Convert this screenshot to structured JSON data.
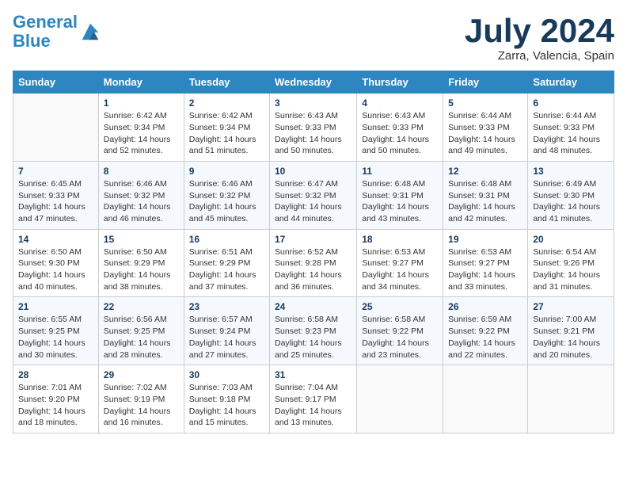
{
  "header": {
    "logo_line1": "General",
    "logo_line2": "Blue",
    "month_title": "July 2024",
    "subtitle": "Zarra, Valencia, Spain"
  },
  "calendar": {
    "days_of_week": [
      "Sunday",
      "Monday",
      "Tuesday",
      "Wednesday",
      "Thursday",
      "Friday",
      "Saturday"
    ],
    "weeks": [
      [
        {
          "day": "",
          "info": ""
        },
        {
          "day": "1",
          "info": "Sunrise: 6:42 AM\nSunset: 9:34 PM\nDaylight: 14 hours\nand 52 minutes."
        },
        {
          "day": "2",
          "info": "Sunrise: 6:42 AM\nSunset: 9:34 PM\nDaylight: 14 hours\nand 51 minutes."
        },
        {
          "day": "3",
          "info": "Sunrise: 6:43 AM\nSunset: 9:33 PM\nDaylight: 14 hours\nand 50 minutes."
        },
        {
          "day": "4",
          "info": "Sunrise: 6:43 AM\nSunset: 9:33 PM\nDaylight: 14 hours\nand 50 minutes."
        },
        {
          "day": "5",
          "info": "Sunrise: 6:44 AM\nSunset: 9:33 PM\nDaylight: 14 hours\nand 49 minutes."
        },
        {
          "day": "6",
          "info": "Sunrise: 6:44 AM\nSunset: 9:33 PM\nDaylight: 14 hours\nand 48 minutes."
        }
      ],
      [
        {
          "day": "7",
          "info": "Sunrise: 6:45 AM\nSunset: 9:33 PM\nDaylight: 14 hours\nand 47 minutes."
        },
        {
          "day": "8",
          "info": "Sunrise: 6:46 AM\nSunset: 9:32 PM\nDaylight: 14 hours\nand 46 minutes."
        },
        {
          "day": "9",
          "info": "Sunrise: 6:46 AM\nSunset: 9:32 PM\nDaylight: 14 hours\nand 45 minutes."
        },
        {
          "day": "10",
          "info": "Sunrise: 6:47 AM\nSunset: 9:32 PM\nDaylight: 14 hours\nand 44 minutes."
        },
        {
          "day": "11",
          "info": "Sunrise: 6:48 AM\nSunset: 9:31 PM\nDaylight: 14 hours\nand 43 minutes."
        },
        {
          "day": "12",
          "info": "Sunrise: 6:48 AM\nSunset: 9:31 PM\nDaylight: 14 hours\nand 42 minutes."
        },
        {
          "day": "13",
          "info": "Sunrise: 6:49 AM\nSunset: 9:30 PM\nDaylight: 14 hours\nand 41 minutes."
        }
      ],
      [
        {
          "day": "14",
          "info": "Sunrise: 6:50 AM\nSunset: 9:30 PM\nDaylight: 14 hours\nand 40 minutes."
        },
        {
          "day": "15",
          "info": "Sunrise: 6:50 AM\nSunset: 9:29 PM\nDaylight: 14 hours\nand 38 minutes."
        },
        {
          "day": "16",
          "info": "Sunrise: 6:51 AM\nSunset: 9:29 PM\nDaylight: 14 hours\nand 37 minutes."
        },
        {
          "day": "17",
          "info": "Sunrise: 6:52 AM\nSunset: 9:28 PM\nDaylight: 14 hours\nand 36 minutes."
        },
        {
          "day": "18",
          "info": "Sunrise: 6:53 AM\nSunset: 9:27 PM\nDaylight: 14 hours\nand 34 minutes."
        },
        {
          "day": "19",
          "info": "Sunrise: 6:53 AM\nSunset: 9:27 PM\nDaylight: 14 hours\nand 33 minutes."
        },
        {
          "day": "20",
          "info": "Sunrise: 6:54 AM\nSunset: 9:26 PM\nDaylight: 14 hours\nand 31 minutes."
        }
      ],
      [
        {
          "day": "21",
          "info": "Sunrise: 6:55 AM\nSunset: 9:25 PM\nDaylight: 14 hours\nand 30 minutes."
        },
        {
          "day": "22",
          "info": "Sunrise: 6:56 AM\nSunset: 9:25 PM\nDaylight: 14 hours\nand 28 minutes."
        },
        {
          "day": "23",
          "info": "Sunrise: 6:57 AM\nSunset: 9:24 PM\nDaylight: 14 hours\nand 27 minutes."
        },
        {
          "day": "24",
          "info": "Sunrise: 6:58 AM\nSunset: 9:23 PM\nDaylight: 14 hours\nand 25 minutes."
        },
        {
          "day": "25",
          "info": "Sunrise: 6:58 AM\nSunset: 9:22 PM\nDaylight: 14 hours\nand 23 minutes."
        },
        {
          "day": "26",
          "info": "Sunrise: 6:59 AM\nSunset: 9:22 PM\nDaylight: 14 hours\nand 22 minutes."
        },
        {
          "day": "27",
          "info": "Sunrise: 7:00 AM\nSunset: 9:21 PM\nDaylight: 14 hours\nand 20 minutes."
        }
      ],
      [
        {
          "day": "28",
          "info": "Sunrise: 7:01 AM\nSunset: 9:20 PM\nDaylight: 14 hours\nand 18 minutes."
        },
        {
          "day": "29",
          "info": "Sunrise: 7:02 AM\nSunset: 9:19 PM\nDaylight: 14 hours\nand 16 minutes."
        },
        {
          "day": "30",
          "info": "Sunrise: 7:03 AM\nSunset: 9:18 PM\nDaylight: 14 hours\nand 15 minutes."
        },
        {
          "day": "31",
          "info": "Sunrise: 7:04 AM\nSunset: 9:17 PM\nDaylight: 14 hours\nand 13 minutes."
        },
        {
          "day": "",
          "info": ""
        },
        {
          "day": "",
          "info": ""
        },
        {
          "day": "",
          "info": ""
        }
      ]
    ]
  }
}
